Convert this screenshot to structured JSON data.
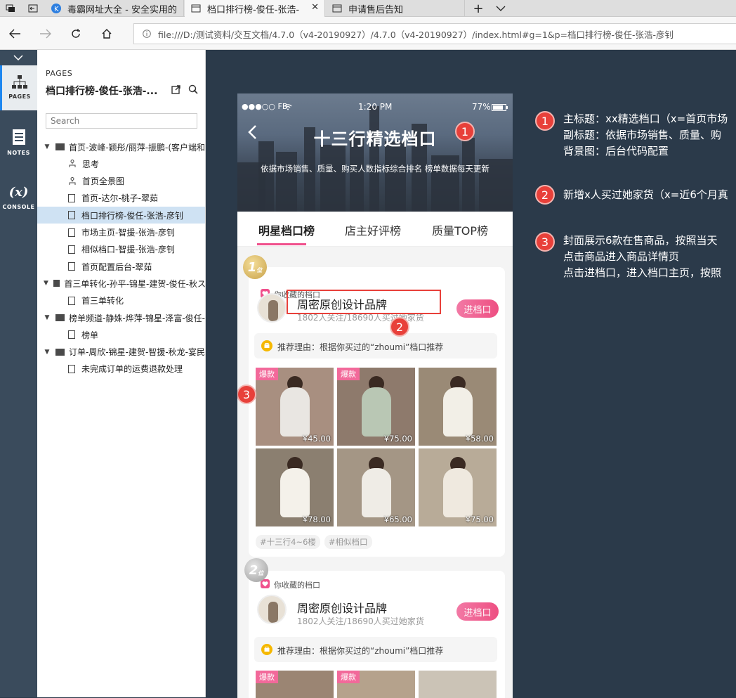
{
  "browser": {
    "tabs": [
      {
        "title": "毒霸网址大全 - 安全实用的"
      },
      {
        "title": "档口排行榜-俊任-张浩-"
      },
      {
        "title": "申请售后告知"
      }
    ],
    "address": "file:///D:/测试资料/交互文档/4.7.0（v4-20190927）/4.7.0（v4-20190927）/index.html#g=1&p=档口排行榜-俊任-张浩-彦钊"
  },
  "rail": {
    "pages_label": "PAGES",
    "notes_label": "NOTES",
    "console_label": "CONSOLE",
    "console_glyph": "(x)"
  },
  "sidebar": {
    "heading": "PAGES",
    "project_title": "档口排行榜-俊任-张浩-...",
    "search_placeholder": "Search",
    "tree": [
      {
        "label": "首页-波峰-颖彤/丽萍-振鹏-(客户端和",
        "type": "folder",
        "level": 0
      },
      {
        "label": "思考",
        "type": "flow",
        "level": 1
      },
      {
        "label": "首页全景图",
        "type": "flow",
        "level": 1
      },
      {
        "label": "首页-达尔-桃子-翠茹",
        "type": "page",
        "level": 1
      },
      {
        "label": "档口排行榜-俊任-张浩-彦钊",
        "type": "page",
        "level": 1,
        "selected": true
      },
      {
        "label": "市场主页-智援-张浩-彦钊",
        "type": "page",
        "level": 1
      },
      {
        "label": "相似档口-智援-张浩-彦钊",
        "type": "page",
        "level": 1
      },
      {
        "label": "首页配置后台-翠茹",
        "type": "page",
        "level": 1
      },
      {
        "label": "首三单转化-孙平-锦星-建贺-俊任-秋ス",
        "type": "folder",
        "level": 0
      },
      {
        "label": "首三单转化",
        "type": "page",
        "level": 1
      },
      {
        "label": "榜单频道-静姝-烨萍-锦星-泽富-俊任-",
        "type": "folder",
        "level": 0
      },
      {
        "label": "榜单",
        "type": "page",
        "level": 1
      },
      {
        "label": "订单-周欣-锦星-建贺-智援-秋龙-宴民",
        "type": "folder",
        "level": 0
      },
      {
        "label": "未完成订单的运费退款处理",
        "type": "page",
        "level": 1
      }
    ]
  },
  "phone": {
    "status": {
      "carrier": "●●●○○ FB",
      "time": "1:20 PM",
      "battery": "77%"
    },
    "title": "十三行精选档口",
    "subtitle": "依据市场销售、质量、购买人数指标综合排名 榜单数据每天更新",
    "tabs": [
      "明星档口榜",
      "店主好评榜",
      "质量TOP榜"
    ],
    "cards": [
      {
        "rank": "1",
        "rank_suffix": "位",
        "fav_label": "你收藏的档口",
        "shop_name": "周密原创设计品牌",
        "stats": "1802人关注/18690人买过她家货",
        "enter_label": "进档口",
        "reason": "推荐理由：根据你买过的“zhoumi”档口推荐",
        "hot_label": "爆款",
        "products": [
          {
            "price": "¥45.00",
            "hot": true
          },
          {
            "price": "¥75.00",
            "hot": true
          },
          {
            "price": "¥58.00",
            "hot": false
          },
          {
            "price": "¥78.00",
            "hot": false
          },
          {
            "price": "¥65.00",
            "hot": false
          },
          {
            "price": "¥75.00",
            "hot": false
          }
        ],
        "tags": [
          "#十三行4~6楼",
          "#相似档口"
        ]
      },
      {
        "rank": "2",
        "rank_suffix": "位",
        "fav_label": "你收藏的档口",
        "shop_name": "周密原创设计品牌",
        "stats": "1802人关注/18690人买过她家货",
        "enter_label": "进档口",
        "reason": "推荐理由：根据你买过的“zhoumi”档口推荐",
        "hot_label": "爆款"
      }
    ],
    "markers": [
      "1",
      "2",
      "3"
    ]
  },
  "notes": [
    {
      "num": "1",
      "lines": [
        "主标题：xx精选档口（x=首页市场",
        "副标题：依据市场销售、质量、购",
        "背景图：后台代码配置"
      ]
    },
    {
      "num": "2",
      "lines": [
        "新增x人买过她家货（x=近6个月真"
      ]
    },
    {
      "num": "3",
      "lines": [
        "封面展示6款在售商品，按照当天",
        "点击商品进入商品详情页",
        "点击进档口，进入档口主页，按照"
      ]
    }
  ],
  "colors": {
    "accent": "#f0508c",
    "marker": "#e8403a",
    "canvas": "#2b3a4a",
    "selected_row": "#cfe2f3"
  }
}
